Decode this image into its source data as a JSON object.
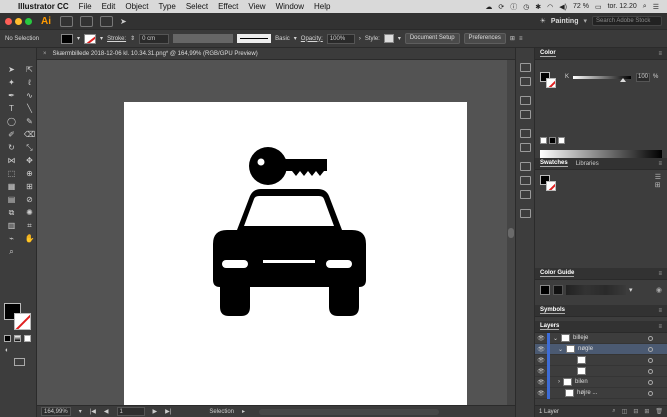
{
  "menubar": {
    "app_name": "Illustrator CC",
    "items": [
      "File",
      "Edit",
      "Object",
      "Type",
      "Select",
      "Effect",
      "View",
      "Window",
      "Help"
    ],
    "battery": "72 %",
    "clock": "tor. 12.20"
  },
  "appbar": {
    "logo": "Ai",
    "workspace": "Painting",
    "search_placeholder": "Search Adobe Stock"
  },
  "control": {
    "selection": "No Selection",
    "stroke_label": "Stroke:",
    "stroke_value": "0 cm",
    "brush": "Basic",
    "opacity_label": "Opacity:",
    "opacity_value": "100%",
    "style_label": "Style:",
    "doc_setup": "Document Setup",
    "preferences": "Preferences"
  },
  "document": {
    "tab_title": "Skærmbillede 2018-12-06 kl. 10.34.31.png* @ 164,99% (RGB/GPU Preview)"
  },
  "status": {
    "zoom": "164,99%",
    "page": "1",
    "tool": "Selection"
  },
  "panels": {
    "color": {
      "title": "Color",
      "k_label": "K",
      "k_value": "100",
      "k_unit": "%"
    },
    "swatches": {
      "tab1": "Swatches",
      "tab2": "Libraries"
    },
    "color_guide": {
      "title": "Color Guide"
    },
    "symbols": {
      "title": "Symbols"
    },
    "layers": {
      "title": "Layers",
      "rows": [
        {
          "name": "billeje",
          "selected": false
        },
        {
          "name": "nøgle",
          "selected": true
        },
        {
          "name": "",
          "selected": false
        },
        {
          "name": "",
          "selected": false
        },
        {
          "name": "bilen",
          "selected": false
        },
        {
          "name": "højre ...",
          "selected": false
        }
      ],
      "count": "1 Layer"
    }
  },
  "colors": {
    "accent": "#3d6cd6",
    "stroke_none": "#e02020",
    "ai_orange": "#ff9a00"
  }
}
